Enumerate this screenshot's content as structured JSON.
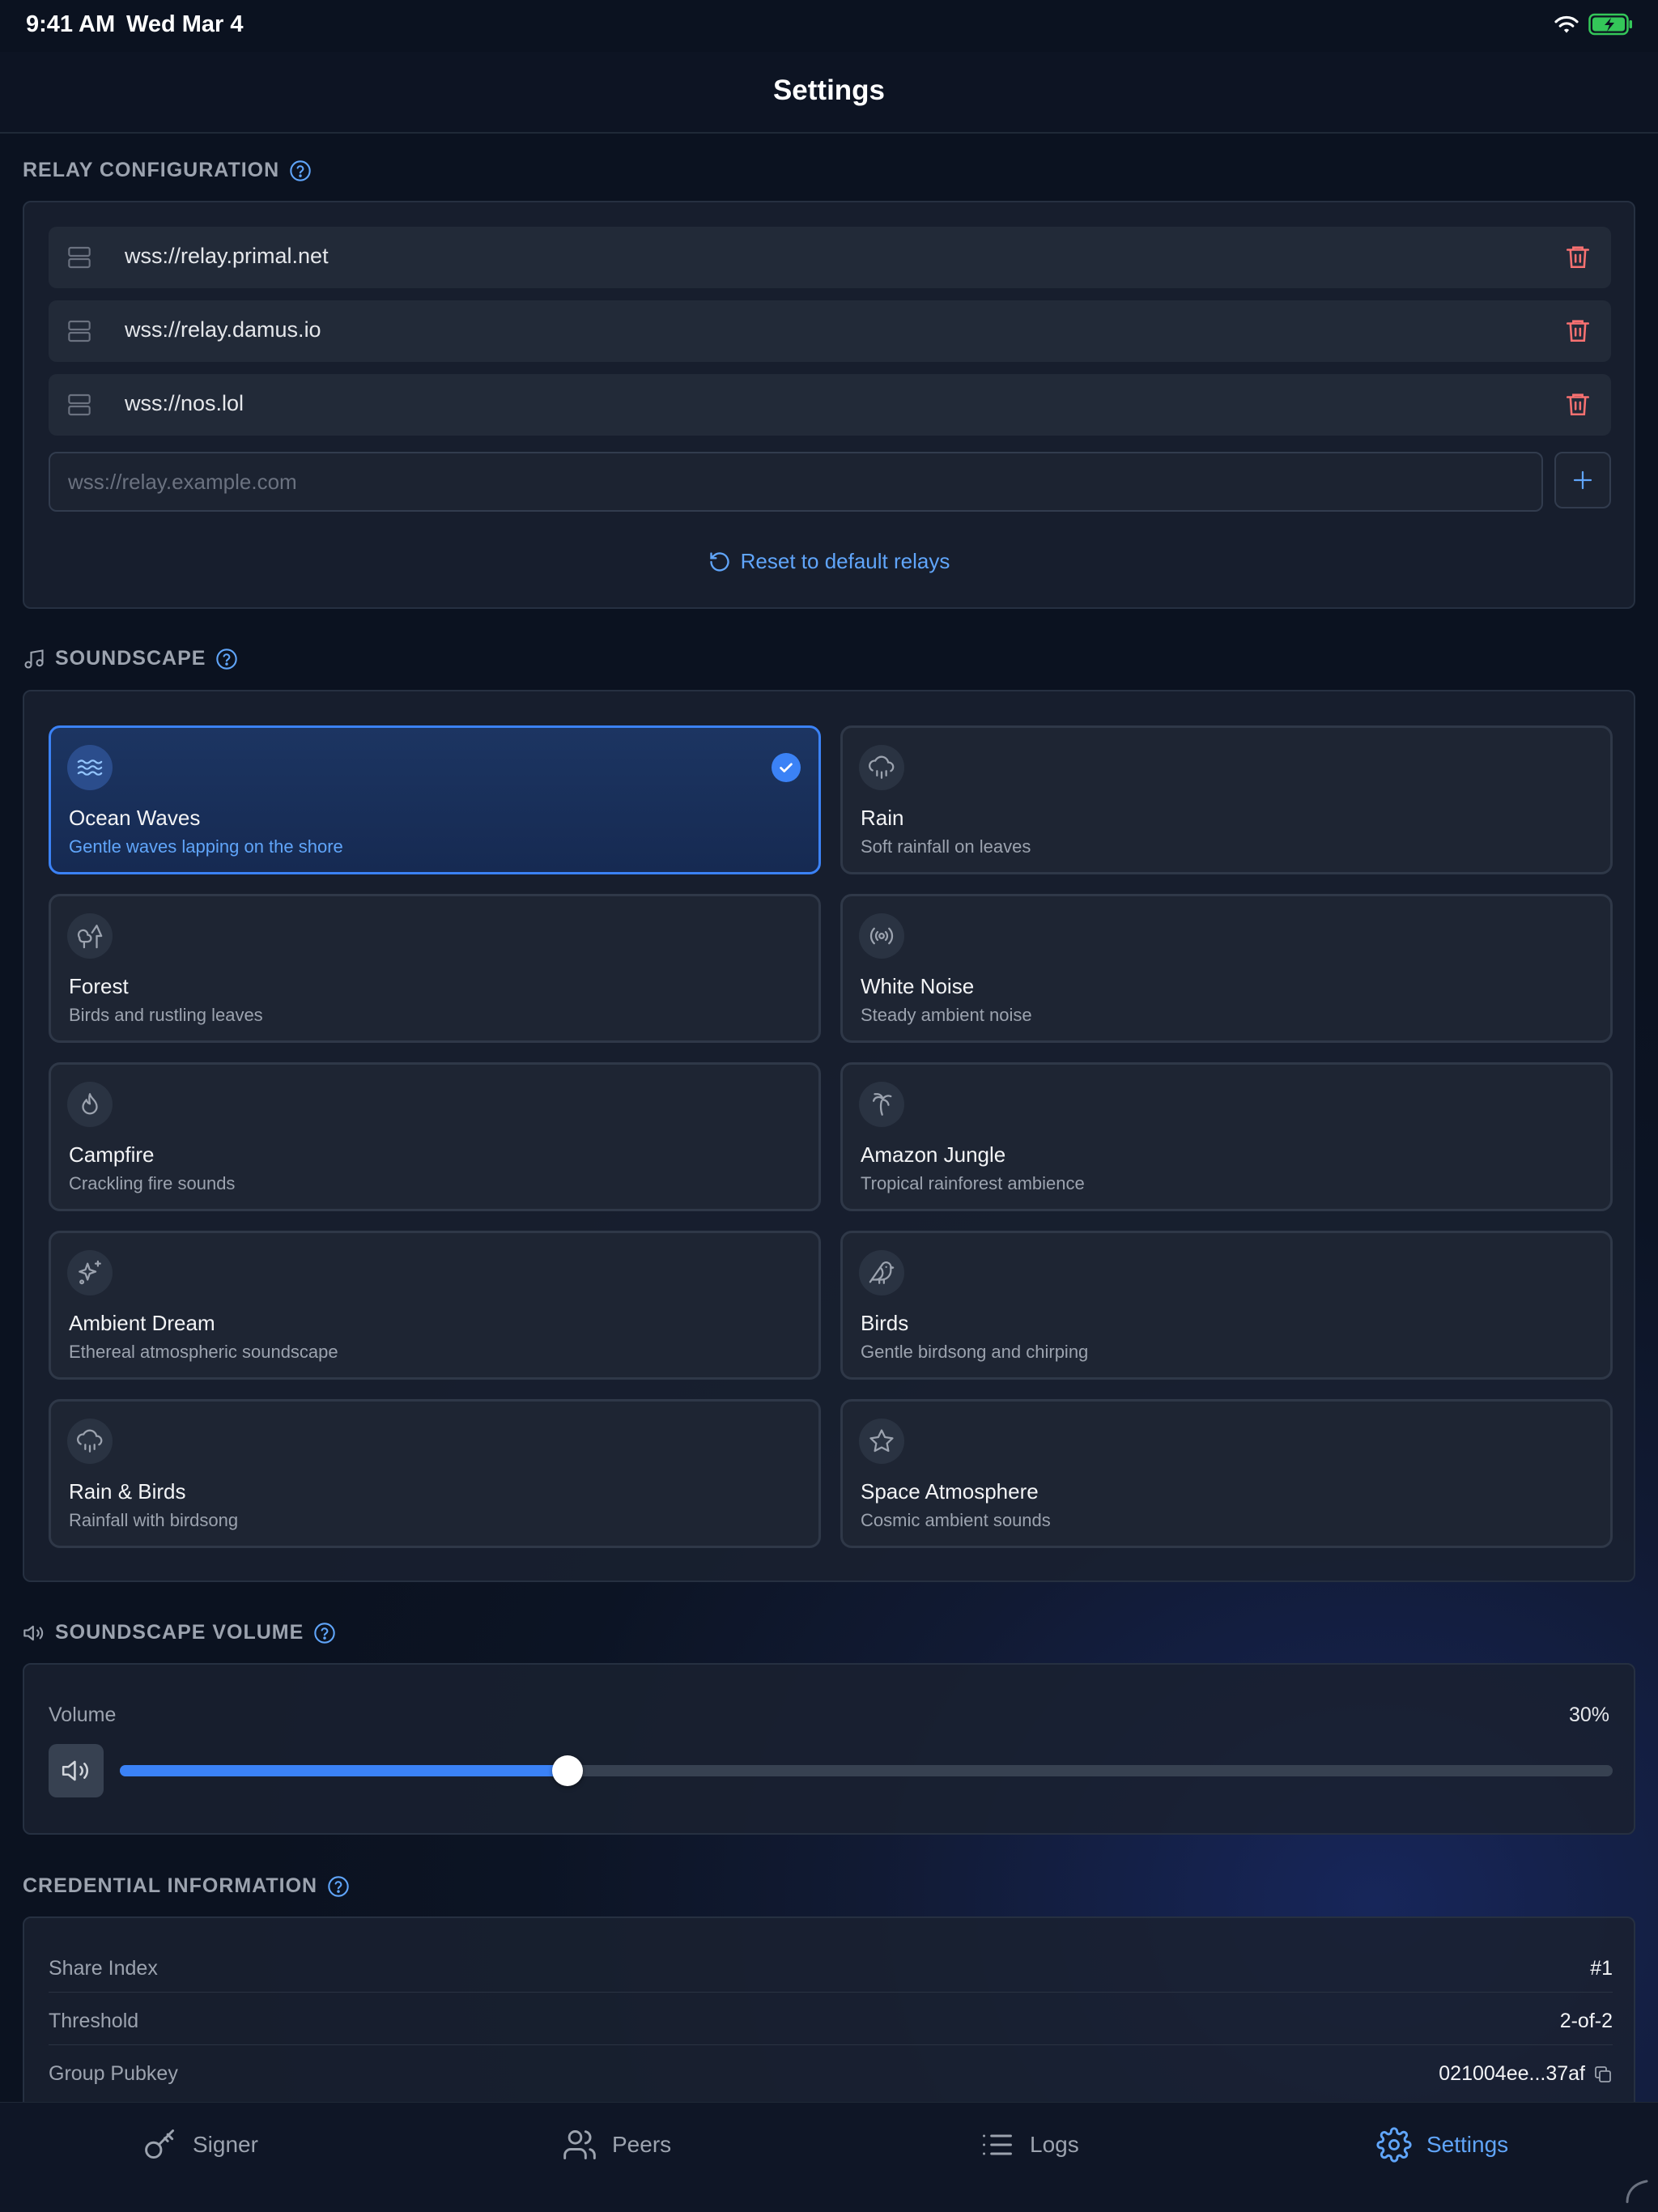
{
  "status": {
    "time": "9:41 AM",
    "date": "Wed Mar 4"
  },
  "header": {
    "title": "Settings"
  },
  "relay": {
    "title": "RELAY CONFIGURATION",
    "items": [
      {
        "url": "wss://relay.primal.net"
      },
      {
        "url": "wss://relay.damus.io"
      },
      {
        "url": "wss://nos.lol"
      }
    ],
    "input_placeholder": "wss://relay.example.com",
    "reset_label": "Reset to default relays"
  },
  "soundscape": {
    "title": "SOUNDSCAPE",
    "selected": "Ocean Waves",
    "options": [
      {
        "name": "Ocean Waves",
        "desc": "Gentle waves lapping on the shore",
        "icon": "waves-icon"
      },
      {
        "name": "Rain",
        "desc": "Soft rainfall on leaves",
        "icon": "cloud-rain-icon"
      },
      {
        "name": "Forest",
        "desc": "Birds and rustling leaves",
        "icon": "trees-icon"
      },
      {
        "name": "White Noise",
        "desc": "Steady ambient noise",
        "icon": "radio-icon"
      },
      {
        "name": "Campfire",
        "desc": "Crackling fire sounds",
        "icon": "flame-icon"
      },
      {
        "name": "Amazon Jungle",
        "desc": "Tropical rainforest ambience",
        "icon": "palm-tree-icon"
      },
      {
        "name": "Ambient Dream",
        "desc": "Ethereal atmospheric soundscape",
        "icon": "sparkles-icon"
      },
      {
        "name": "Birds",
        "desc": "Gentle birdsong and chirping",
        "icon": "bird-icon"
      },
      {
        "name": "Rain & Birds",
        "desc": "Rainfall with birdsong",
        "icon": "cloud-rain-icon"
      },
      {
        "name": "Space Atmosphere",
        "desc": "Cosmic ambient sounds",
        "icon": "star-icon"
      }
    ]
  },
  "volume": {
    "title": "SOUNDSCAPE VOLUME",
    "label": "Volume",
    "value": 30,
    "display": "30%"
  },
  "credential": {
    "title": "CREDENTIAL INFORMATION",
    "rows": [
      {
        "key": "Share Index",
        "value": "#1"
      },
      {
        "key": "Threshold",
        "value": "2-of-2"
      },
      {
        "key": "Group Pubkey",
        "value": "021004ee...37af"
      }
    ]
  },
  "tabs": [
    {
      "label": "Signer",
      "icon": "key-icon"
    },
    {
      "label": "Peers",
      "icon": "users-icon"
    },
    {
      "label": "Logs",
      "icon": "list-icon"
    },
    {
      "label": "Settings",
      "icon": "gear-icon",
      "active": true
    }
  ],
  "colors": {
    "accent": "#3b82f6",
    "danger": "#f87171",
    "background": "#0b1220"
  }
}
